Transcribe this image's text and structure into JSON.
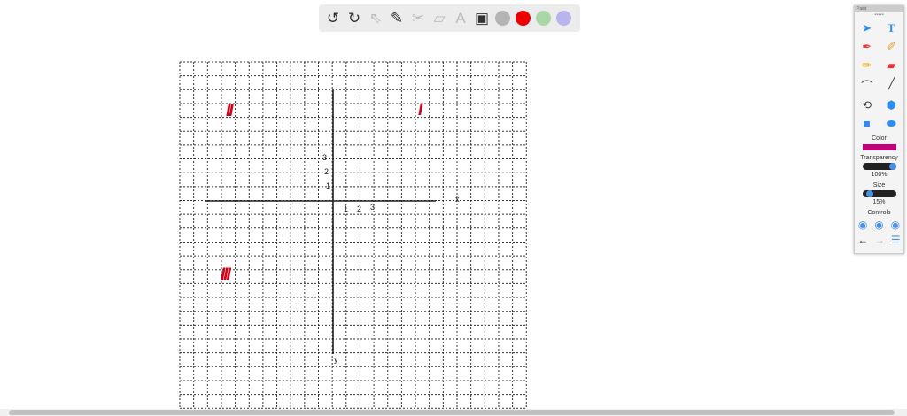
{
  "toolbar": {
    "tools": [
      {
        "name": "undo-icon",
        "glyph": "↺",
        "disabled": false
      },
      {
        "name": "redo-icon",
        "glyph": "↻",
        "disabled": false
      },
      {
        "name": "pointer-icon",
        "glyph": "⇖",
        "disabled": true
      },
      {
        "name": "pencil-icon",
        "glyph": "✎",
        "disabled": false
      },
      {
        "name": "tools-icon",
        "glyph": "✂",
        "disabled": true
      },
      {
        "name": "eraser-icon",
        "glyph": "▱",
        "disabled": true
      },
      {
        "name": "text-box-icon",
        "glyph": "A",
        "disabled": true
      },
      {
        "name": "image-icon",
        "glyph": "▣",
        "disabled": false
      }
    ],
    "colors": [
      "#b4b4b4",
      "#ee0000",
      "#a8d8a8",
      "#b8b4ec"
    ]
  },
  "graph": {
    "x_label": "x",
    "y_label": "y",
    "x_ticks": [
      "1",
      "2",
      "3"
    ],
    "y_ticks": [
      "1",
      "2",
      "3"
    ],
    "quadrants": [
      "I",
      "II",
      "III"
    ]
  },
  "panel": {
    "title": "Paint",
    "color_label": "Color",
    "color": "#c2007a",
    "transparency_label": "Transparency",
    "transparency_value": "100%",
    "transparency": 1.0,
    "size_label": "Size",
    "size_value": "15%",
    "size": 0.15,
    "controls_label": "Controls"
  }
}
